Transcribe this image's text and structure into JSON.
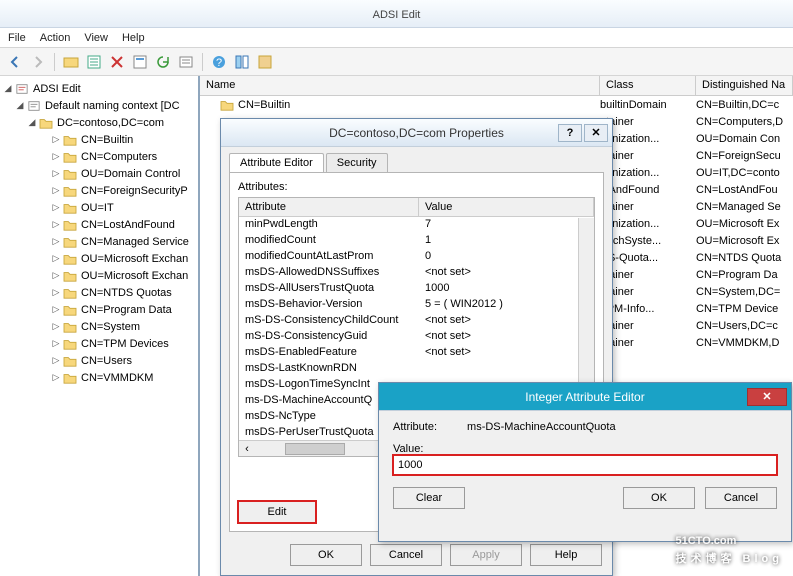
{
  "window": {
    "title": "ADSI Edit"
  },
  "menus": [
    "File",
    "Action",
    "View",
    "Help"
  ],
  "tree": {
    "root": "ADSI Edit",
    "ctx": "Default naming context [DC",
    "dc": "DC=contoso,DC=com",
    "children": [
      "CN=Builtin",
      "CN=Computers",
      "OU=Domain Control",
      "CN=ForeignSecurityP",
      "OU=IT",
      "CN=LostAndFound",
      "CN=Managed Service",
      "OU=Microsoft Exchan",
      "OU=Microsoft Exchan",
      "CN=NTDS Quotas",
      "CN=Program Data",
      "CN=System",
      "CN=TPM Devices",
      "CN=Users",
      "CN=VMMDKM"
    ]
  },
  "list": {
    "headers": [
      "Name",
      "Class",
      "Distinguished Na"
    ],
    "rows": [
      {
        "n": "CN=Builtin",
        "c": "builtinDomain",
        "d": "CN=Builtin,DC=c"
      },
      {
        "n": "",
        "c": "ntainer",
        "d": "CN=Computers,D"
      },
      {
        "n": "",
        "c": "ganization...",
        "d": "OU=Domain Con"
      },
      {
        "n": "",
        "c": "ntainer",
        "d": "CN=ForeignSecu"
      },
      {
        "n": "",
        "c": "ganization...",
        "d": "OU=IT,DC=conto"
      },
      {
        "n": "",
        "c": "stAndFound",
        "d": "CN=LostAndFou"
      },
      {
        "n": "",
        "c": "ntainer",
        "d": "CN=Managed Se"
      },
      {
        "n": "",
        "c": "ganization...",
        "d": "OU=Microsoft Ex"
      },
      {
        "n": "",
        "c": "ExchSyste...",
        "d": "OU=Microsoft Ex"
      },
      {
        "n": "",
        "c": "DS-Quota...",
        "d": "CN=NTDS Quota"
      },
      {
        "n": "",
        "c": "ntainer",
        "d": "CN=Program Da"
      },
      {
        "n": "",
        "c": "ntainer",
        "d": "CN=System,DC="
      },
      {
        "n": "",
        "c": "TPM-Info...",
        "d": "CN=TPM Device"
      },
      {
        "n": "",
        "c": "ntainer",
        "d": "CN=Users,DC=c"
      },
      {
        "n": "",
        "c": "ntainer",
        "d": "CN=VMMDKM,D"
      }
    ]
  },
  "propDlg": {
    "title": "DC=contoso,DC=com Properties",
    "tabs": [
      "Attribute Editor",
      "Security"
    ],
    "label": "Attributes:",
    "cols": [
      "Attribute",
      "Value"
    ],
    "rows": [
      {
        "a": "minPwdLength",
        "v": "7"
      },
      {
        "a": "modifiedCount",
        "v": "1"
      },
      {
        "a": "modifiedCountAtLastProm",
        "v": "0"
      },
      {
        "a": "msDS-AllowedDNSSuffixes",
        "v": "<not set>"
      },
      {
        "a": "msDS-AllUsersTrustQuota",
        "v": "1000"
      },
      {
        "a": "msDS-Behavior-Version",
        "v": "5 = ( WIN2012 )"
      },
      {
        "a": "mS-DS-ConsistencyChildCount",
        "v": "<not set>"
      },
      {
        "a": "mS-DS-ConsistencyGuid",
        "v": "<not set>"
      },
      {
        "a": "msDS-EnabledFeature",
        "v": "<not set>"
      },
      {
        "a": "msDS-LastKnownRDN",
        "v": ""
      },
      {
        "a": "msDS-LogonTimeSyncInt",
        "v": ""
      },
      {
        "a": "ms-DS-MachineAccountQ",
        "v": ""
      },
      {
        "a": "msDS-NcType",
        "v": ""
      },
      {
        "a": "msDS-PerUserTrustQuota",
        "v": ""
      }
    ],
    "edit": "Edit",
    "buttons": {
      "ok": "OK",
      "cancel": "Cancel",
      "apply": "Apply",
      "help": "Help"
    }
  },
  "intDlg": {
    "title": "Integer Attribute Editor",
    "attrLabel": "Attribute:",
    "attrValue": "ms-DS-MachineAccountQuota",
    "valLabel": "Value:",
    "value": "1000",
    "clear": "Clear",
    "ok": "OK",
    "cancel": "Cancel"
  },
  "watermark": {
    "big": "51CTO.com",
    "small": "技术博客   Blog"
  }
}
